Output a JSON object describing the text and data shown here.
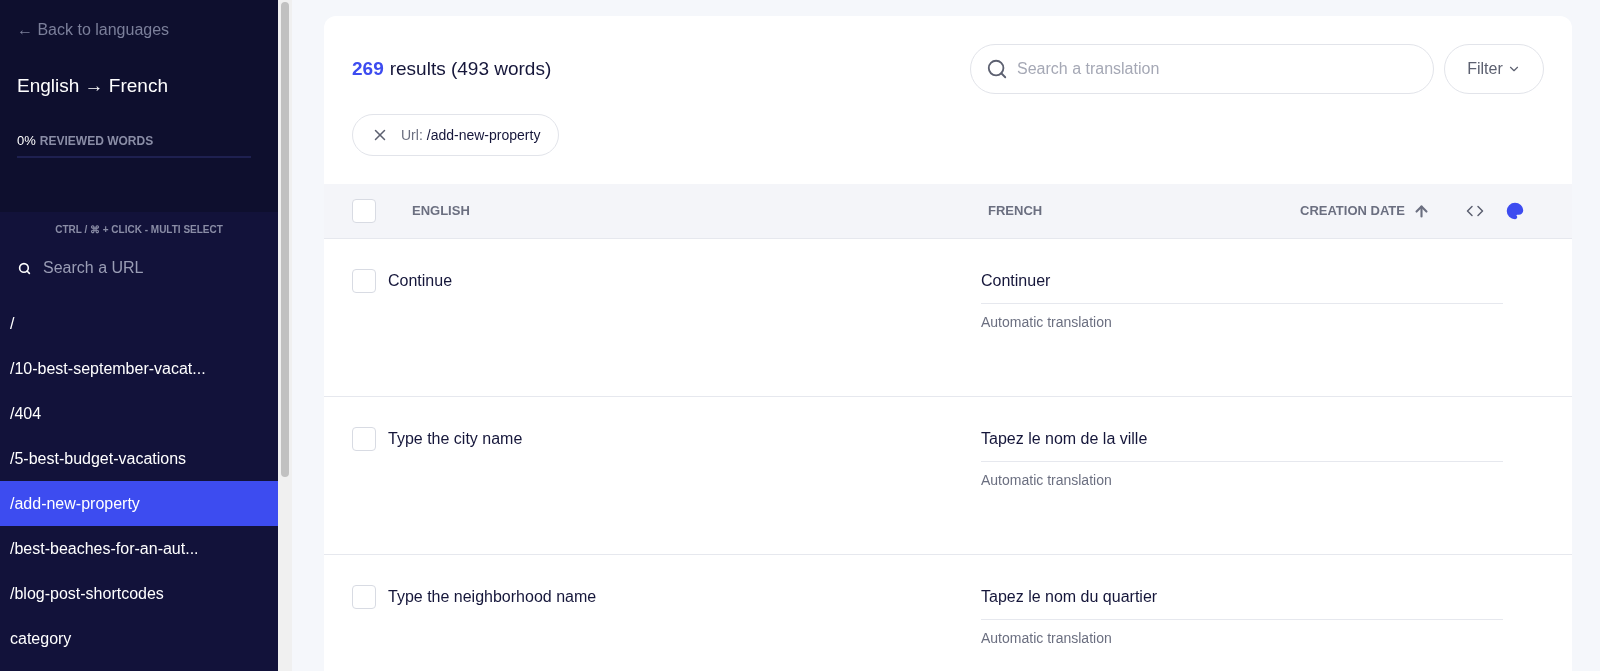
{
  "sidebar": {
    "back_link": "← Back to languages",
    "title": "English → French",
    "progress": {
      "percent": "0%",
      "label": "REVIEWED WORDS",
      "level": 0
    },
    "hint": "CTRL / ⌘ + CLICK - MULTI SELECT",
    "search": {
      "placeholder": "Search a URL"
    },
    "items": [
      {
        "label": "/",
        "selected": false
      },
      {
        "label": "/10-best-september-vacat...",
        "selected": false
      },
      {
        "label": "/404",
        "selected": false
      },
      {
        "label": "/5-best-budget-vacations",
        "selected": false
      },
      {
        "label": "/add-new-property",
        "selected": true
      },
      {
        "label": "/best-beaches-for-an-aut...",
        "selected": false
      },
      {
        "label": "/blog-post-shortcodes",
        "selected": false
      },
      {
        "label": "category",
        "selected": false
      }
    ]
  },
  "results": {
    "count": "269",
    "text": "results (493 words)"
  },
  "search": {
    "placeholder": "Search a translation"
  },
  "filter_button": "Filter",
  "active_filter": {
    "key": "Url:",
    "value": "/add-new-property"
  },
  "table": {
    "select_all_checked": false,
    "columns": [
      "ENGLISH",
      "FRENCH",
      "CREATION DATE"
    ],
    "rows": [
      {
        "checked": false,
        "source": "Continue",
        "translation": "Continuer",
        "status": "Automatic translation"
      },
      {
        "checked": false,
        "source": "Type the city name",
        "translation": "Tapez le nom de la ville",
        "status": "Automatic translation"
      },
      {
        "checked": false,
        "source": "Type the neighborhood name",
        "translation": "Tapez le nom du quartier",
        "status": "Automatic translation"
      }
    ]
  }
}
